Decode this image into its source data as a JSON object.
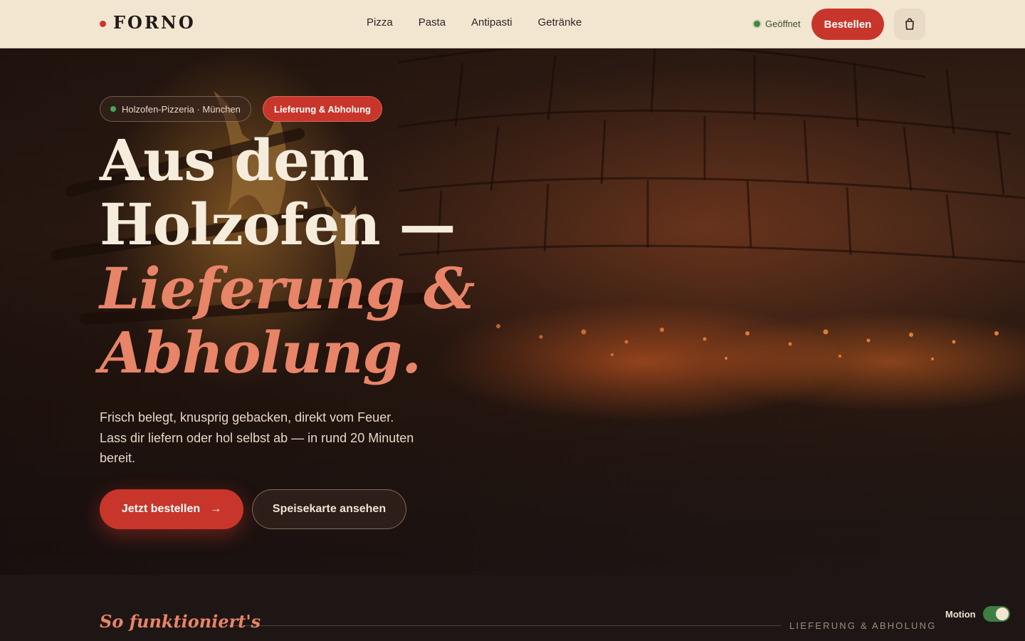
{
  "header": {
    "logo": "FORNO",
    "nav": [
      "Pizza",
      "Pasta",
      "Antipasti",
      "Getränke"
    ],
    "status": "Geöffnet",
    "order_label": "Bestellen",
    "cart_icon": "shopping-bag-icon"
  },
  "hero": {
    "badge_location": "Holzofen-Pizzeria · München",
    "badge_service": "Lieferung & Abholung",
    "headline_line1": "Aus dem",
    "headline_line2": "Holzofen —",
    "headline_accent1": "Lieferung &",
    "headline_accent2": "Abholung.",
    "lead": "Frisch belegt, knusprig gebacken, direkt vom Feuer. Lass dir liefern oder hol selbst ab — in rund 20 Minuten bereit.",
    "cta_primary": "Jetzt bestellen",
    "cta_primary_arrow": "→",
    "cta_secondary": "Speisekarte ansehen"
  },
  "section": {
    "title": "So funktioniert's",
    "tag": "LIEFERUNG & ABHOLUNG"
  },
  "motion": {
    "label": "Motion",
    "enabled": true
  },
  "colors": {
    "accent": "#c8362b",
    "accent_soft": "#e88468",
    "header_bg": "#f3e6d1",
    "open_green": "#3e8a44"
  }
}
